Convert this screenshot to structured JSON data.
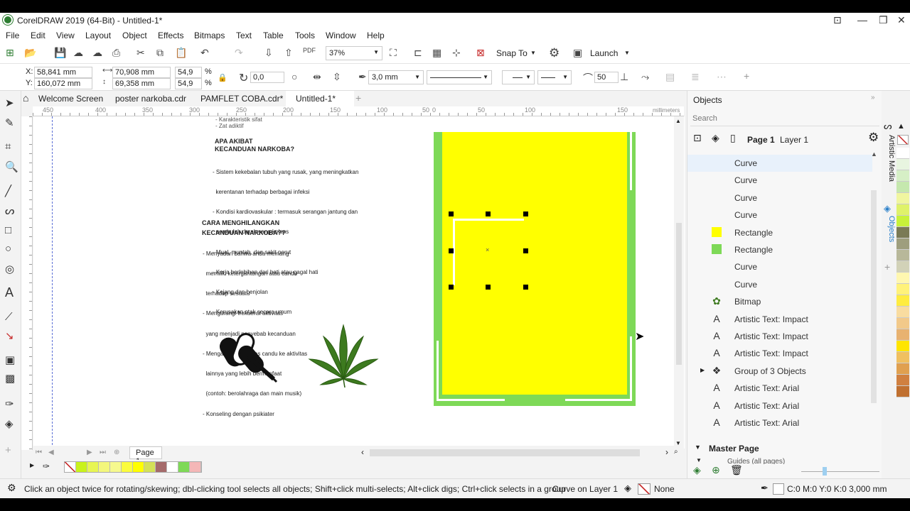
{
  "window": {
    "title": "CorelDRAW 2019 (64-Bit) - Untitled-1*"
  },
  "menu": [
    "File",
    "Edit",
    "View",
    "Layout",
    "Object",
    "Effects",
    "Bitmaps",
    "Text",
    "Table",
    "Tools",
    "Window",
    "Help"
  ],
  "toolbar": {
    "zoom": "37%",
    "snap_to": "Snap To",
    "launch": "Launch"
  },
  "property_bar": {
    "x": "58,841 mm",
    "y": "160,072 mm",
    "width": "70,908 mm",
    "height": "69,358 mm",
    "scale_w": "54,9",
    "scale_h": "54,9",
    "pct1": "%",
    "pct2": "%",
    "rotation": "0,0",
    "outline_width": "3,0 mm",
    "smoothing": "50"
  },
  "tabs": [
    "Welcome Screen",
    "poster narkoba.cdr",
    "PAMFLET COBA.cdr*",
    "Untitled-1*"
  ],
  "ruler": {
    "ticks": [
      "450",
      "400",
      "350",
      "300",
      "250",
      "200",
      "150",
      "100",
      "50",
      "0",
      "50",
      "100",
      "150"
    ],
    "unit": "millimeters"
  },
  "document": {
    "lines_top": [
      "- Karakteristik sifat",
      "- Zat adiktif"
    ],
    "heading1": [
      "APA AKIBAT",
      "KECANDUAN NARKOBA?"
    ],
    "list1": [
      "- Sistem kekebalan tubuh yang rusak, yang meningkatkan",
      "  kerentanan terhadap berbagai infeksi",
      "- Kondisi kardiovaskular : termasuk serangan jantung dan",
      "  pembuluh darah yang kolaps",
      "- Mual, muntah, dan sakit perut",
      "- Kerja berlebihan dari hati atau gagal hati",
      "- Kejang dan benjolan",
      "- Kerusakan otak secara umum"
    ],
    "heading2": [
      "CARA MENGHILANGKAN",
      "KECANDUAN NARKOBA??"
    ],
    "list2": [
      "- Menyadari bahwa anda memang",
      "  memiliki ketergantungan atau candu",
      "  terhadap sesuatu",
      "- Mengurangi frekuensi aktivitas",
      "  yang menjadi penyebab kecanduan",
      "- Mengalihkan aktivitas candu ke aktivitas",
      "  lainnya yang lebih bermanfaat",
      "  (contoh: berolahraga dan main musik)",
      "- Konseling dengan psikiater"
    ],
    "colors": {
      "yellow": "#ffff00",
      "green": "#7ed957"
    }
  },
  "page_nav": {
    "page": "Page 1"
  },
  "palette_swatches": [
    "#ffffff",
    "#c9f21c",
    "#e7f553",
    "#f3f77c",
    "#f6f98e",
    "#fbfc3e",
    "#fffe00",
    "#d4e157",
    "#a56b6b",
    "#ffffff",
    "#7ed957",
    "#f4b7b7"
  ],
  "status": {
    "hint": "Click an object twice for rotating/skewing; dbl-clicking tool selects all objects; Shift+click multi-selects; Alt+click digs; Ctrl+click selects in a group",
    "selection": "Curve on Layer 1",
    "fill": "None",
    "outline": "C:0 M:0 Y:0 K:0  3,000 mm"
  },
  "docker": {
    "title": "Objects",
    "search_placeholder": "Search",
    "page": "Page 1",
    "layer": "Layer 1",
    "items": [
      {
        "label": "Curve",
        "icon": "curve"
      },
      {
        "label": "Curve",
        "icon": "curve"
      },
      {
        "label": "Curve",
        "icon": "curve"
      },
      {
        "label": "Curve",
        "icon": "curve"
      },
      {
        "label": "Rectangle",
        "icon": "rect-yellow"
      },
      {
        "label": "Rectangle",
        "icon": "rect-green"
      },
      {
        "label": "Curve",
        "icon": "curve"
      },
      {
        "label": "Curve",
        "icon": "curve"
      },
      {
        "label": "Bitmap",
        "icon": "bitmap"
      },
      {
        "label": "Artistic Text: Impact",
        "icon": "text"
      },
      {
        "label": "Artistic Text: Impact",
        "icon": "text"
      },
      {
        "label": "Artistic Text: Impact",
        "icon": "text"
      },
      {
        "label": "Group of 3 Objects",
        "icon": "group"
      },
      {
        "label": "Artistic Text: Arial",
        "icon": "text"
      },
      {
        "label": "Artistic Text: Arial",
        "icon": "text"
      },
      {
        "label": "Artistic Text: Arial",
        "icon": "text"
      }
    ],
    "master_page": "Master Page",
    "guides": "Guides (all pages)"
  },
  "side_tabs": {
    "artistic_media": "Artistic Media",
    "objects": "Objects"
  },
  "right_palette": [
    "#ffffff",
    "#e8f5e0",
    "#d6efc6",
    "#c5e8ae",
    "#f0f6a0",
    "#dff26a",
    "#c8f23a",
    "#7a7a55",
    "#9e9e7e",
    "#b8b89a",
    "#d2d2b8",
    "#fff7b0",
    "#fff27a",
    "#ffec40",
    "#f9dca0",
    "#f2c98a",
    "#e8b270",
    "#ffe500",
    "#f0c060",
    "#e0a050",
    "#d08040",
    "#c07030"
  ]
}
